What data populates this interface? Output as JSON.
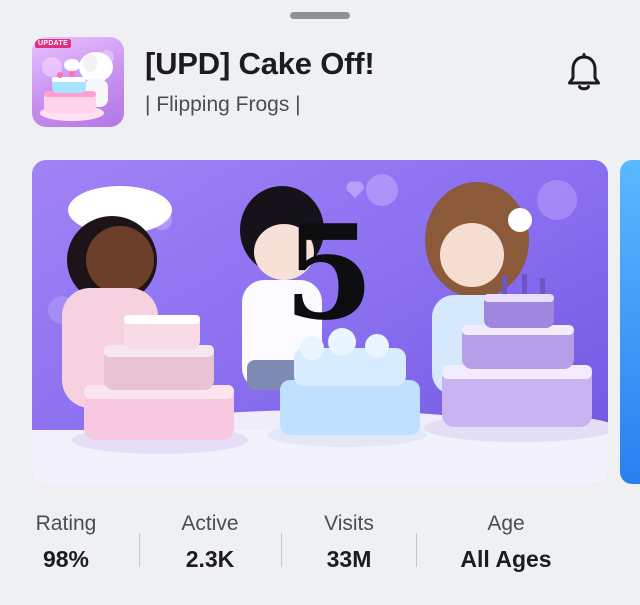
{
  "header": {
    "icon_badge": "UPDATE",
    "title": "[UPD] Cake Off!",
    "creator": "| Flipping Frogs |"
  },
  "banner": {
    "overlay_number": "5"
  },
  "stats": [
    {
      "label": "Rating",
      "value": "98%"
    },
    {
      "label": "Active",
      "value": "2.3K"
    },
    {
      "label": "Visits",
      "value": "33M"
    },
    {
      "label": "Age",
      "value": "All Ages"
    }
  ],
  "icons": {
    "grabber": "sheet-grabber",
    "notify": "bell-icon"
  },
  "colors": {
    "background": "#eff0f2",
    "banner_purple": "#8a6ff0",
    "text_primary": "#1b1c1f",
    "text_secondary": "#4a4d55"
  }
}
